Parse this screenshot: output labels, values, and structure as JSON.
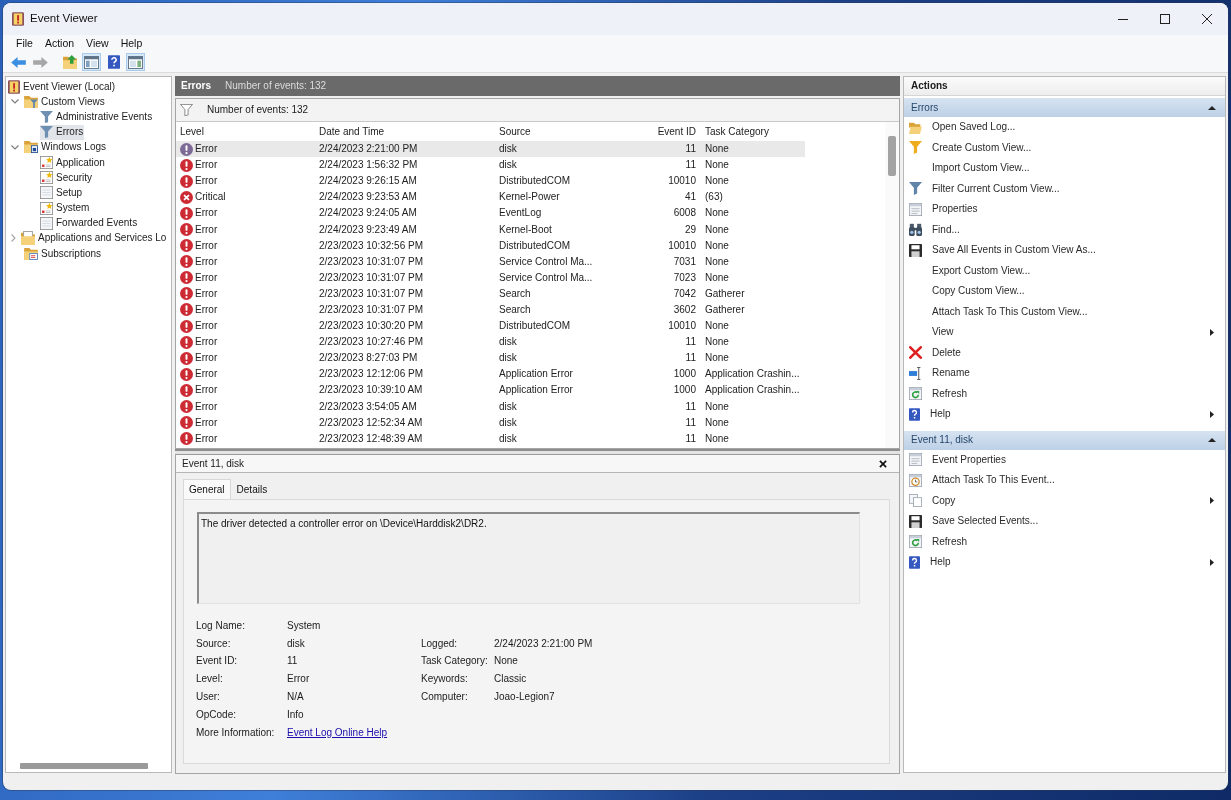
{
  "window": {
    "title": "Event Viewer"
  },
  "menu": [
    "File",
    "Action",
    "View",
    "Help"
  ],
  "toolbar": [
    [
      {
        "kind": "back",
        "pressed": false,
        "disabled": false
      },
      {
        "kind": "forward",
        "pressed": false,
        "disabled": true
      }
    ],
    [
      {
        "kind": "up",
        "pressed": false,
        "disabled": false
      },
      {
        "kind": "console-tree",
        "pressed": true,
        "disabled": false
      },
      {
        "kind": "help",
        "pressed": false,
        "disabled": false
      },
      {
        "kind": "action-pane",
        "pressed": true,
        "disabled": false
      }
    ]
  ],
  "tree": [
    {
      "kind": "root",
      "label": "Event Viewer (Local)",
      "selected": false,
      "children": [
        {
          "kind": "views",
          "label": "Custom Views",
          "expanded": true,
          "selected": false,
          "children": [
            {
              "kind": "filter",
              "label": "Administrative Events",
              "selected": false
            },
            {
              "kind": "filter",
              "label": "Errors",
              "selected": true
            }
          ]
        },
        {
          "kind": "logs",
          "label": "Windows Logs",
          "expanded": true,
          "selected": false,
          "children": [
            {
              "kind": "log",
              "label": "Application",
              "selected": false
            },
            {
              "kind": "log",
              "label": "Security",
              "selected": false
            },
            {
              "kind": "page",
              "label": "Setup",
              "selected": false
            },
            {
              "kind": "log",
              "label": "System",
              "selected": false
            },
            {
              "kind": "page",
              "label": "Forwarded Events",
              "selected": false
            }
          ]
        },
        {
          "kind": "folder",
          "label": "Applications and Services Lo",
          "expanded": false,
          "selected": false
        },
        {
          "kind": "subscriptions",
          "label": "Subscriptions",
          "selected": false
        }
      ]
    }
  ],
  "center": {
    "title": "Errors",
    "count": "Number of events: 132",
    "filter_text": "Number of events: 132",
    "columns": [
      "Level",
      "Date and Time",
      "Source",
      "Event ID",
      "Task Category"
    ],
    "rows": [
      {
        "kind": "error",
        "selected": true,
        "cells": [
          "Error",
          "2/24/2023 2:21:00 PM",
          "disk",
          "11",
          "None"
        ]
      },
      {
        "kind": "error",
        "selected": false,
        "cells": [
          "Error",
          "2/24/2023 1:56:32 PM",
          "disk",
          "11",
          "None"
        ]
      },
      {
        "kind": "error",
        "selected": false,
        "cells": [
          "Error",
          "2/24/2023 9:26:15 AM",
          "DistributedCOM",
          "10010",
          "None"
        ]
      },
      {
        "kind": "critical",
        "selected": false,
        "cells": [
          "Critical",
          "2/24/2023 9:23:53 AM",
          "Kernel-Power",
          "41",
          "(63)"
        ]
      },
      {
        "kind": "error",
        "selected": false,
        "cells": [
          "Error",
          "2/24/2023 9:24:05 AM",
          "EventLog",
          "6008",
          "None"
        ]
      },
      {
        "kind": "error",
        "selected": false,
        "cells": [
          "Error",
          "2/24/2023 9:23:49 AM",
          "Kernel-Boot",
          "29",
          "None"
        ]
      },
      {
        "kind": "error",
        "selected": false,
        "cells": [
          "Error",
          "2/23/2023 10:32:56 PM",
          "DistributedCOM",
          "10010",
          "None"
        ]
      },
      {
        "kind": "error",
        "selected": false,
        "cells": [
          "Error",
          "2/23/2023 10:31:07 PM",
          "Service Control Ma...",
          "7031",
          "None"
        ]
      },
      {
        "kind": "error",
        "selected": false,
        "cells": [
          "Error",
          "2/23/2023 10:31:07 PM",
          "Service Control Ma...",
          "7023",
          "None"
        ]
      },
      {
        "kind": "error",
        "selected": false,
        "cells": [
          "Error",
          "2/23/2023 10:31:07 PM",
          "Search",
          "7042",
          "Gatherer"
        ]
      },
      {
        "kind": "error",
        "selected": false,
        "cells": [
          "Error",
          "2/23/2023 10:31:07 PM",
          "Search",
          "3602",
          "Gatherer"
        ]
      },
      {
        "kind": "error",
        "selected": false,
        "cells": [
          "Error",
          "2/23/2023 10:30:20 PM",
          "DistributedCOM",
          "10010",
          "None"
        ]
      },
      {
        "kind": "error",
        "selected": false,
        "cells": [
          "Error",
          "2/23/2023 10:27:46 PM",
          "disk",
          "11",
          "None"
        ]
      },
      {
        "kind": "error",
        "selected": false,
        "cells": [
          "Error",
          "2/23/2023 8:27:03 PM",
          "disk",
          "11",
          "None"
        ]
      },
      {
        "kind": "error",
        "selected": false,
        "cells": [
          "Error",
          "2/23/2023 12:12:06 PM",
          "Application Error",
          "1000",
          "Application Crashin..."
        ]
      },
      {
        "kind": "error",
        "selected": false,
        "cells": [
          "Error",
          "2/23/2023 10:39:10 AM",
          "Application Error",
          "1000",
          "Application Crashin..."
        ]
      },
      {
        "kind": "error",
        "selected": false,
        "cells": [
          "Error",
          "2/23/2023 3:54:05 AM",
          "disk",
          "11",
          "None"
        ]
      },
      {
        "kind": "error",
        "selected": false,
        "cells": [
          "Error",
          "2/23/2023 12:52:34 AM",
          "disk",
          "11",
          "None"
        ]
      },
      {
        "kind": "error",
        "selected": false,
        "cells": [
          "Error",
          "2/23/2023 12:48:39 AM",
          "disk",
          "11",
          "None"
        ]
      }
    ]
  },
  "detail": {
    "title": "Event 11, disk",
    "tabs": [
      {
        "label": "General",
        "selected": true
      },
      {
        "label": "Details",
        "selected": false
      }
    ],
    "message": "The driver detected a controller error on \\Device\\Harddisk2\\DR2.",
    "fields": [
      {
        "left": {
          "label": "Log Name:",
          "value": "System"
        }
      },
      {
        "left": {
          "label": "Source:",
          "value": "disk"
        },
        "right": {
          "label": "Logged:",
          "value": "2/24/2023 2:21:00 PM"
        }
      },
      {
        "left": {
          "label": "Event ID:",
          "value": "11"
        },
        "right": {
          "label": "Task Category:",
          "value": "None"
        }
      },
      {
        "left": {
          "label": "Level:",
          "value": "Error"
        },
        "right": {
          "label": "Keywords:",
          "value": "Classic"
        }
      },
      {
        "left": {
          "label": "User:",
          "value": "N/A"
        },
        "right": {
          "label": "Computer:",
          "value": "Joao-Legion7"
        }
      },
      {
        "left": {
          "label": "OpCode:",
          "value": "Info"
        }
      },
      {
        "left": {
          "label": "More Information:",
          "link": "Event Log Online Help"
        }
      }
    ]
  },
  "actions": {
    "title": "Actions",
    "sections": [
      {
        "title": "Errors",
        "expanded": true,
        "items": [
          {
            "kind": "open",
            "label": "Open Saved Log...",
            "submenu": false
          },
          {
            "kind": "create",
            "label": "Create Custom View...",
            "submenu": false
          },
          {
            "kind": "plain",
            "label": "Import Custom View...",
            "submenu": false
          },
          {
            "kind": "filter",
            "label": "Filter Current Custom View...",
            "submenu": false
          },
          {
            "kind": "properties",
            "label": "Properties",
            "submenu": false
          },
          {
            "kind": "find",
            "label": "Find...",
            "submenu": false
          },
          {
            "kind": "save",
            "label": "Save All Events in Custom View As...",
            "submenu": false
          },
          {
            "kind": "plain",
            "label": "Export Custom View...",
            "submenu": false
          },
          {
            "kind": "plain",
            "label": "Copy Custom View...",
            "submenu": false
          },
          {
            "kind": "plain",
            "label": "Attach Task To This Custom View...",
            "submenu": false
          },
          {
            "kind": "plain",
            "label": "View",
            "submenu": true
          },
          {
            "kind": "delete",
            "label": "Delete",
            "submenu": false
          },
          {
            "kind": "rename",
            "label": "Rename",
            "submenu": false
          },
          {
            "kind": "refresh",
            "label": "Refresh",
            "submenu": false
          },
          {
            "kind": "help",
            "label": "Help",
            "submenu": true
          }
        ]
      },
      {
        "title": "Event 11, disk",
        "expanded": true,
        "items": [
          {
            "kind": "properties",
            "label": "Event Properties",
            "submenu": false
          },
          {
            "kind": "task",
            "label": "Attach Task To This Event...",
            "submenu": false
          },
          {
            "kind": "copy",
            "label": "Copy",
            "submenu": true
          },
          {
            "kind": "save",
            "label": "Save Selected Events...",
            "submenu": false
          },
          {
            "kind": "refresh",
            "label": "Refresh",
            "submenu": false
          },
          {
            "kind": "help",
            "label": "Help",
            "submenu": true
          }
        ]
      }
    ]
  }
}
